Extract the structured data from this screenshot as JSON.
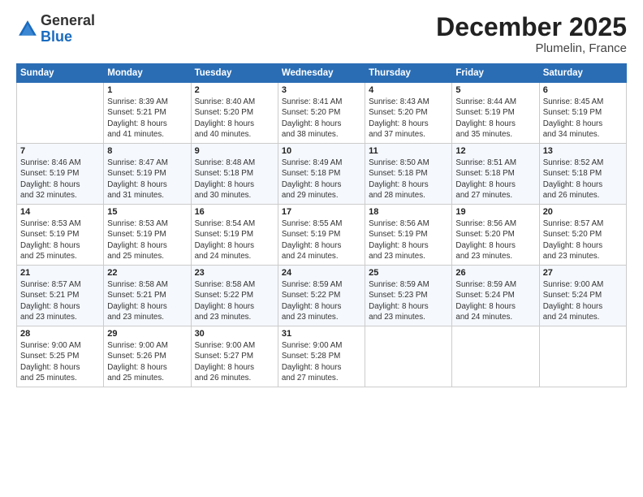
{
  "header": {
    "logo_general": "General",
    "logo_blue": "Blue",
    "month": "December 2025",
    "location": "Plumelin, France"
  },
  "days_of_week": [
    "Sunday",
    "Monday",
    "Tuesday",
    "Wednesday",
    "Thursday",
    "Friday",
    "Saturday"
  ],
  "weeks": [
    [
      {
        "num": "",
        "info": ""
      },
      {
        "num": "1",
        "info": "Sunrise: 8:39 AM\nSunset: 5:21 PM\nDaylight: 8 hours\nand 41 minutes."
      },
      {
        "num": "2",
        "info": "Sunrise: 8:40 AM\nSunset: 5:20 PM\nDaylight: 8 hours\nand 40 minutes."
      },
      {
        "num": "3",
        "info": "Sunrise: 8:41 AM\nSunset: 5:20 PM\nDaylight: 8 hours\nand 38 minutes."
      },
      {
        "num": "4",
        "info": "Sunrise: 8:43 AM\nSunset: 5:20 PM\nDaylight: 8 hours\nand 37 minutes."
      },
      {
        "num": "5",
        "info": "Sunrise: 8:44 AM\nSunset: 5:19 PM\nDaylight: 8 hours\nand 35 minutes."
      },
      {
        "num": "6",
        "info": "Sunrise: 8:45 AM\nSunset: 5:19 PM\nDaylight: 8 hours\nand 34 minutes."
      }
    ],
    [
      {
        "num": "7",
        "info": "Sunrise: 8:46 AM\nSunset: 5:19 PM\nDaylight: 8 hours\nand 32 minutes."
      },
      {
        "num": "8",
        "info": "Sunrise: 8:47 AM\nSunset: 5:19 PM\nDaylight: 8 hours\nand 31 minutes."
      },
      {
        "num": "9",
        "info": "Sunrise: 8:48 AM\nSunset: 5:18 PM\nDaylight: 8 hours\nand 30 minutes."
      },
      {
        "num": "10",
        "info": "Sunrise: 8:49 AM\nSunset: 5:18 PM\nDaylight: 8 hours\nand 29 minutes."
      },
      {
        "num": "11",
        "info": "Sunrise: 8:50 AM\nSunset: 5:18 PM\nDaylight: 8 hours\nand 28 minutes."
      },
      {
        "num": "12",
        "info": "Sunrise: 8:51 AM\nSunset: 5:18 PM\nDaylight: 8 hours\nand 27 minutes."
      },
      {
        "num": "13",
        "info": "Sunrise: 8:52 AM\nSunset: 5:18 PM\nDaylight: 8 hours\nand 26 minutes."
      }
    ],
    [
      {
        "num": "14",
        "info": "Sunrise: 8:53 AM\nSunset: 5:19 PM\nDaylight: 8 hours\nand 25 minutes."
      },
      {
        "num": "15",
        "info": "Sunrise: 8:53 AM\nSunset: 5:19 PM\nDaylight: 8 hours\nand 25 minutes."
      },
      {
        "num": "16",
        "info": "Sunrise: 8:54 AM\nSunset: 5:19 PM\nDaylight: 8 hours\nand 24 minutes."
      },
      {
        "num": "17",
        "info": "Sunrise: 8:55 AM\nSunset: 5:19 PM\nDaylight: 8 hours\nand 24 minutes."
      },
      {
        "num": "18",
        "info": "Sunrise: 8:56 AM\nSunset: 5:19 PM\nDaylight: 8 hours\nand 23 minutes."
      },
      {
        "num": "19",
        "info": "Sunrise: 8:56 AM\nSunset: 5:20 PM\nDaylight: 8 hours\nand 23 minutes."
      },
      {
        "num": "20",
        "info": "Sunrise: 8:57 AM\nSunset: 5:20 PM\nDaylight: 8 hours\nand 23 minutes."
      }
    ],
    [
      {
        "num": "21",
        "info": "Sunrise: 8:57 AM\nSunset: 5:21 PM\nDaylight: 8 hours\nand 23 minutes."
      },
      {
        "num": "22",
        "info": "Sunrise: 8:58 AM\nSunset: 5:21 PM\nDaylight: 8 hours\nand 23 minutes."
      },
      {
        "num": "23",
        "info": "Sunrise: 8:58 AM\nSunset: 5:22 PM\nDaylight: 8 hours\nand 23 minutes."
      },
      {
        "num": "24",
        "info": "Sunrise: 8:59 AM\nSunset: 5:22 PM\nDaylight: 8 hours\nand 23 minutes."
      },
      {
        "num": "25",
        "info": "Sunrise: 8:59 AM\nSunset: 5:23 PM\nDaylight: 8 hours\nand 23 minutes."
      },
      {
        "num": "26",
        "info": "Sunrise: 8:59 AM\nSunset: 5:24 PM\nDaylight: 8 hours\nand 24 minutes."
      },
      {
        "num": "27",
        "info": "Sunrise: 9:00 AM\nSunset: 5:24 PM\nDaylight: 8 hours\nand 24 minutes."
      }
    ],
    [
      {
        "num": "28",
        "info": "Sunrise: 9:00 AM\nSunset: 5:25 PM\nDaylight: 8 hours\nand 25 minutes."
      },
      {
        "num": "29",
        "info": "Sunrise: 9:00 AM\nSunset: 5:26 PM\nDaylight: 8 hours\nand 25 minutes."
      },
      {
        "num": "30",
        "info": "Sunrise: 9:00 AM\nSunset: 5:27 PM\nDaylight: 8 hours\nand 26 minutes."
      },
      {
        "num": "31",
        "info": "Sunrise: 9:00 AM\nSunset: 5:28 PM\nDaylight: 8 hours\nand 27 minutes."
      },
      {
        "num": "",
        "info": ""
      },
      {
        "num": "",
        "info": ""
      },
      {
        "num": "",
        "info": ""
      }
    ]
  ]
}
